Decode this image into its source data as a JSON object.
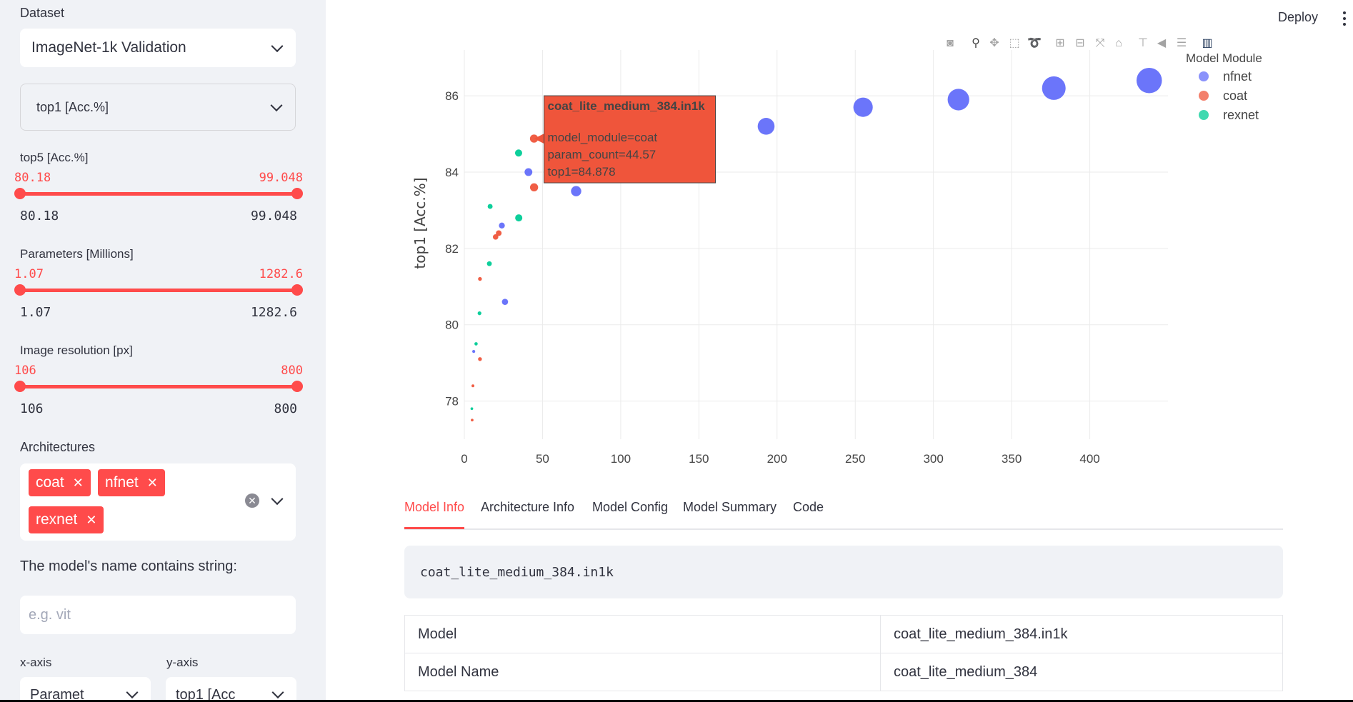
{
  "sidebar": {
    "dataset_label": "Dataset",
    "dataset_value": "ImageNet-1k Validation",
    "metric_value": "top1 [Acc.%]",
    "top5": {
      "label": "top5 [Acc.%]",
      "min": "80.18",
      "max": "99.048",
      "low": "80.18",
      "high": "99.048"
    },
    "params": {
      "label": "Parameters [Millions]",
      "min": "1.07",
      "max": "1282.6",
      "low": "1.07",
      "high": "1282.6"
    },
    "resolution": {
      "label": "Image resolution [px]",
      "min": "106",
      "max": "800",
      "low": "106",
      "high": "800"
    },
    "architectures_label": "Architectures",
    "architectures": [
      "coat",
      "nfnet",
      "rexnet"
    ],
    "name_filter_label": "The model's name contains string:",
    "name_filter_placeholder": "e.g. vit",
    "x_axis_label": "x-axis",
    "y_axis_label": "y-axis",
    "x_axis_value": "Paramet",
    "y_axis_value": "top1 [Acc"
  },
  "header": {
    "deploy_label": "Deploy"
  },
  "chart_data": {
    "type": "scatter",
    "xlabel": "Parameters [Millions]",
    "ylabel": "top1 [Acc.%]",
    "xlim": [
      0,
      450
    ],
    "ylim": [
      77,
      87.2
    ],
    "xticks": [
      0,
      50,
      100,
      150,
      200,
      250,
      300,
      350,
      400
    ],
    "yticks": [
      78,
      80,
      82,
      84,
      86
    ],
    "legend_title": "Model Module",
    "legend_position": "top-right",
    "grid": true,
    "series": [
      {
        "name": "nfnet",
        "color": "#636efa",
        "points": [
          [
            6,
            79.3
          ],
          [
            26,
            80.6
          ],
          [
            24,
            82.6
          ],
          [
            41,
            84.0
          ],
          [
            71.5,
            83.5
          ],
          [
            193,
            85.2
          ],
          [
            255,
            85.7
          ],
          [
            316,
            85.9
          ],
          [
            377,
            86.2
          ],
          [
            438,
            86.4
          ]
        ]
      },
      {
        "name": "coat",
        "color": "#ef553b",
        "points": [
          [
            5,
            77.5
          ],
          [
            5.5,
            78.4
          ],
          [
            10,
            79.1
          ],
          [
            10,
            81.2
          ],
          [
            20,
            82.3
          ],
          [
            22,
            82.4
          ],
          [
            44.6,
            83.6
          ],
          [
            44.57,
            84.878
          ]
        ]
      },
      {
        "name": "rexnet",
        "color": "#00cc96",
        "points": [
          [
            4.8,
            77.8
          ],
          [
            7.5,
            79.5
          ],
          [
            9.7,
            80.3
          ],
          [
            16,
            81.6
          ],
          [
            16.5,
            83.1
          ],
          [
            34.8,
            82.8
          ],
          [
            34.7,
            84.5
          ]
        ]
      }
    ],
    "tooltip": {
      "title": "coat_lite_medium_384.in1k",
      "lines": [
        "model_module=coat",
        "param_count=44.57",
        "top1=84.878"
      ],
      "color": "#ef553b"
    }
  },
  "tabs": [
    "Model Info",
    "Architecture Info",
    "Model Config",
    "Model Summary",
    "Code"
  ],
  "model_info": {
    "code_name": "coat_lite_medium_384.in1k",
    "rows": [
      {
        "key": "Model",
        "value": "coat_lite_medium_384.in1k"
      },
      {
        "key": "Model Name",
        "value": "coat_lite_medium_384"
      }
    ]
  }
}
